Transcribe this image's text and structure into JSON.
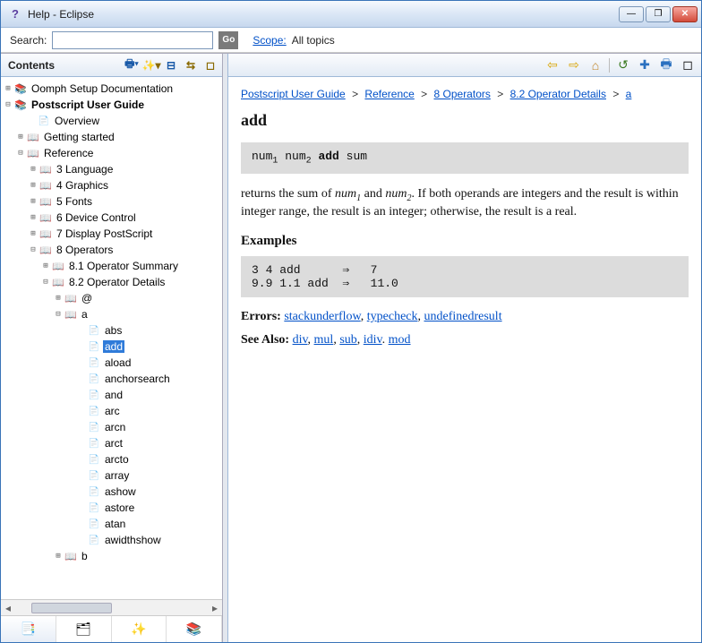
{
  "window": {
    "title": "Help - Eclipse"
  },
  "search": {
    "label": "Search:",
    "placeholder": "",
    "go": "Go",
    "scope_label": "Scope:",
    "scope_value": "All topics"
  },
  "contents_header": "Contents",
  "tree": {
    "oomph": "Oomph Setup Documentation",
    "psug": "Postscript User Guide",
    "overview": "Overview",
    "getting_started": "Getting started",
    "reference": "Reference",
    "lang": "3 Language",
    "graphics": "4 Graphics",
    "fonts": "5 Fonts",
    "device": "6 Device Control",
    "display": "7 Display PostScript",
    "operators": "8 Operators",
    "opsum": "8.1 Operator Summary",
    "opdet": "8.2 Operator Details",
    "at": "@",
    "a": "a",
    "abs": "abs",
    "add": "add",
    "aload": "aload",
    "anchorsearch": "anchorsearch",
    "and": "and",
    "arc": "arc",
    "arcn": "arcn",
    "arct": "arct",
    "arcto": "arcto",
    "array": "array",
    "ashow": "ashow",
    "astore": "astore",
    "atan": "atan",
    "awidthshow": "awidthshow",
    "b": "b"
  },
  "breadcrumb": {
    "l0": "Postscript User Guide",
    "l1": "Reference",
    "l2": "8 Operators",
    "l3": "8.2 Operator Details",
    "l4": "a",
    "sep": ">"
  },
  "article": {
    "title": "add",
    "syntax_pre": "num",
    "syntax_mid": " num",
    "syntax_op": " add ",
    "syntax_res": "sum",
    "desc_pre": "returns the sum of ",
    "desc_n1": "num",
    "desc_and": " and ",
    "desc_n2": "num",
    "desc_post": ". If both operands are integers and the result is within integer range, the result is an integer; otherwise, the result is a real.",
    "examples_h": "Examples",
    "examples_code": "3 4 add      ⇒   7\n9.9 1.1 add  ⇒   11.0",
    "errors_label": "Errors:",
    "errors": [
      "stackunderflow",
      "typecheck",
      "undefinedresult"
    ],
    "seealso_label": "See Also:",
    "seealso": [
      "div",
      "mul",
      "sub",
      "idiv",
      "mod"
    ]
  }
}
